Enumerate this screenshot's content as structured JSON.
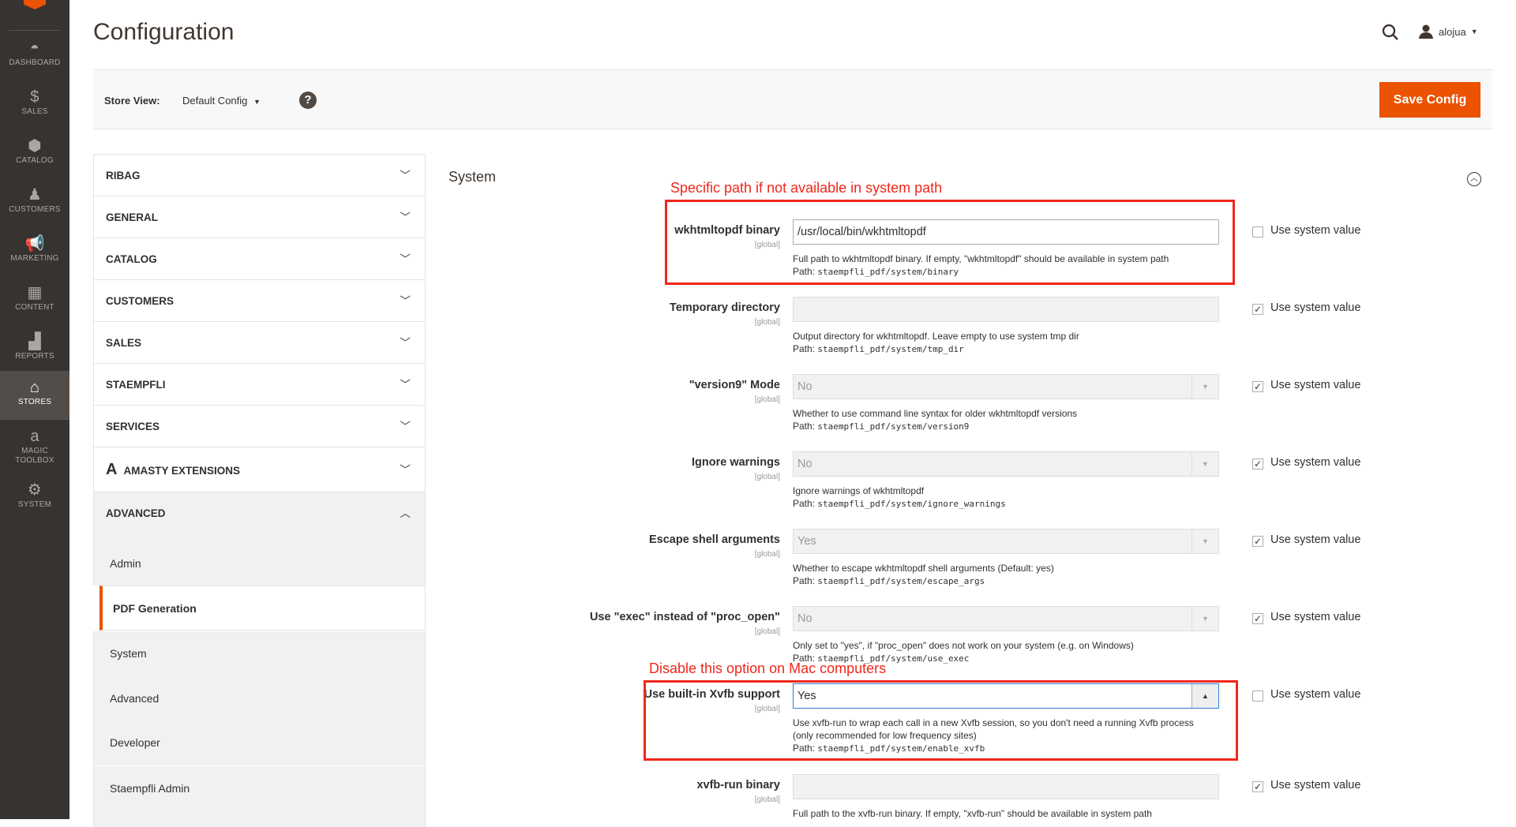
{
  "sidebar": {
    "items": [
      {
        "label": "DASHBOARD",
        "icon": "dashboard-icon",
        "glyph": "◓"
      },
      {
        "label": "SALES",
        "icon": "dollar-icon",
        "glyph": "$"
      },
      {
        "label": "CATALOG",
        "icon": "box-icon",
        "glyph": "⬢"
      },
      {
        "label": "CUSTOMERS",
        "icon": "person-icon",
        "glyph": "♟"
      },
      {
        "label": "MARKETING",
        "icon": "megaphone-icon",
        "glyph": "📢"
      },
      {
        "label": "CONTENT",
        "icon": "layout-icon",
        "glyph": "▦"
      },
      {
        "label": "REPORTS",
        "icon": "bar-chart-icon",
        "glyph": "▟"
      },
      {
        "label": "STORES",
        "icon": "store-icon",
        "glyph": "⌂",
        "active": true
      },
      {
        "label": "MAGIC TOOLBOX",
        "icon": "magic-toolbox-icon",
        "glyph": "a"
      },
      {
        "label": "SYSTEM",
        "icon": "gear-icon",
        "glyph": "⚙"
      }
    ]
  },
  "header": {
    "title": "Configuration",
    "user": "alojua"
  },
  "toolbar": {
    "store_view_label": "Store View:",
    "store_view_value": "Default Config",
    "help": "?",
    "save_label": "Save Config"
  },
  "nav": {
    "sections": [
      "RIBAG",
      "GENERAL",
      "CATALOG",
      "CUSTOMERS",
      "SALES",
      "STAEMPFLI",
      "SERVICES",
      "AMASTY EXTENSIONS",
      "ADVANCED"
    ],
    "advanced_items": [
      "Admin",
      "PDF Generation",
      "System",
      "Advanced",
      "Developer",
      "Staempfli Admin"
    ],
    "active_item": "PDF Generation"
  },
  "section": {
    "title": "System"
  },
  "use_system_label": "Use system value",
  "fields": [
    {
      "label": "wkhtmltopdf binary",
      "scope": "[global]",
      "type": "text",
      "value": "/usr/local/bin/wkhtmltopdf",
      "disabled": false,
      "use_system": false,
      "comment": [
        "Full path to wkhtmltopdf binary. If empty, \"wkhtmltopdf\" should be available in system path"
      ],
      "path_label": "Path:",
      "path": "staempfli_pdf/system/binary"
    },
    {
      "label": "Temporary directory",
      "scope": "[global]",
      "type": "text",
      "value": "",
      "disabled": true,
      "use_system": true,
      "comment": [
        "Output directory for wkhtmltopdf. Leave empty to use system tmp dir"
      ],
      "path_label": "Path:",
      "path": "staempfli_pdf/system/tmp_dir"
    },
    {
      "label": "\"version9\" Mode",
      "scope": "[global]",
      "type": "select",
      "value": "No",
      "disabled": true,
      "use_system": true,
      "comment": [
        "Whether to use command line syntax for older wkhtmltopdf versions"
      ],
      "path_label": "Path:",
      "path": "staempfli_pdf/system/version9"
    },
    {
      "label": "Ignore warnings",
      "scope": "[global]",
      "type": "select",
      "value": "No",
      "disabled": true,
      "use_system": true,
      "comment": [
        "Ignore warnings of wkhtmltopdf"
      ],
      "path_label": "Path:",
      "path": "staempfli_pdf/system/ignore_warnings"
    },
    {
      "label": "Escape shell arguments",
      "scope": "[global]",
      "type": "select",
      "value": "Yes",
      "disabled": true,
      "use_system": true,
      "comment": [
        "Whether to escape wkhtmltopdf shell arguments (Default: yes)"
      ],
      "path_label": "Path:",
      "path": "staempfli_pdf/system/escape_args"
    },
    {
      "label": "Use \"exec\" instead of \"proc_open\"",
      "scope": "[global]",
      "type": "select",
      "value": "No",
      "disabled": true,
      "use_system": true,
      "comment": [
        "Only set to \"yes\", if \"proc_open\" does not work on your system (e.g. on Windows)"
      ],
      "path_label": "Path:",
      "path": "staempfli_pdf/system/use_exec"
    },
    {
      "label": "Use built-in Xvfb support",
      "scope": "[global]",
      "type": "select",
      "value": "Yes",
      "disabled": false,
      "focused": true,
      "use_system": false,
      "comment": [
        "Use xvfb-run to wrap each call in a new Xvfb session, so you don't need a running Xvfb process",
        "(only recommended for low frequency sites)"
      ],
      "path_label": "Path:",
      "path": "staempfli_pdf/system/enable_xvfb"
    },
    {
      "label": "xvfb-run binary",
      "scope": "[global]",
      "type": "text",
      "value": "",
      "disabled": true,
      "use_system": true,
      "comment": [
        "Full path to the xvfb-run binary. If empty, \"xvfb-run\" should be available in system path"
      ]
    }
  ],
  "annotations": [
    {
      "text": "Specific path if not available in system path",
      "color": "#f0271a"
    },
    {
      "text": "Disable this option on Mac computers",
      "color": "#f0271a"
    }
  ],
  "colors": {
    "accent": "#eb5202",
    "sidebar": "#373330"
  }
}
